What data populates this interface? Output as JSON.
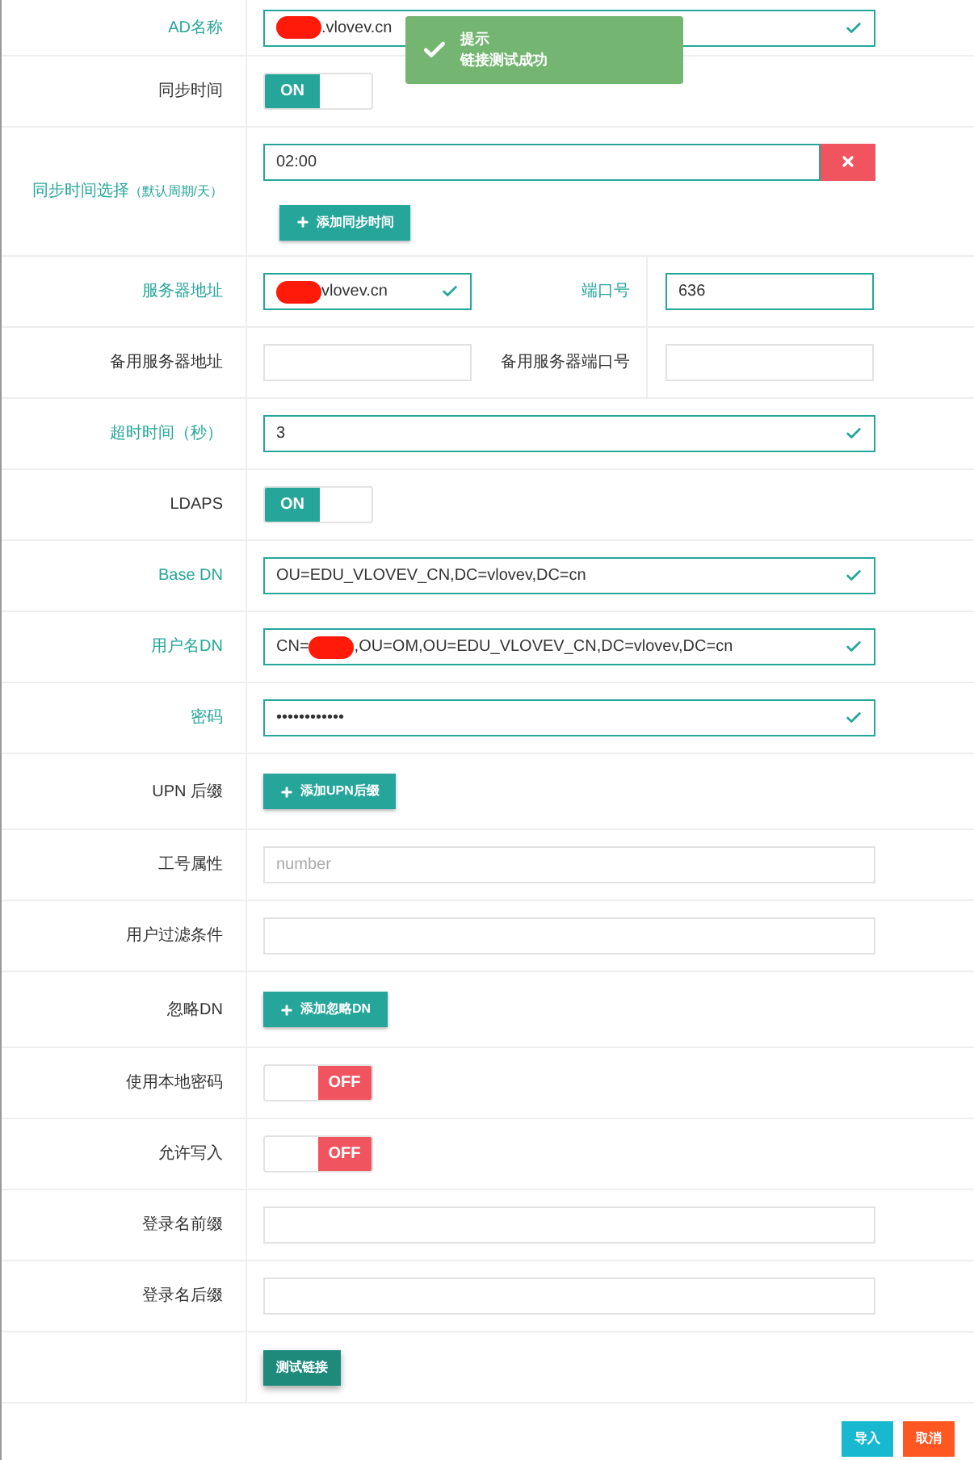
{
  "form_rows": [
    {
      "kind": "input",
      "label": "AD名称",
      "highlighted": true,
      "validated": true,
      "segments": [
        {
          "kind": "redaction"
        },
        {
          "kind": "text",
          "text": ".vlovev.cn"
        }
      ]
    },
    {
      "kind": "switch",
      "label": "同步时间",
      "on": true,
      "switch_text": "ON"
    },
    {
      "kind": "time",
      "label": "同步时间选择",
      "label_note": "（默认周期/天）",
      "highlighted": true,
      "value": "02:00",
      "add_button": "添加同步时间"
    },
    {
      "kind": "dual",
      "fields": [
        {
          "label": "服务器地址",
          "highlighted": true,
          "validated": true,
          "segments": [
            {
              "kind": "redaction"
            },
            {
              "kind": "text",
              "text": "vlovev.cn"
            }
          ]
        },
        {
          "label": "端口号",
          "highlighted": true,
          "validated": false,
          "segments": [
            {
              "kind": "text",
              "text": "636"
            }
          ]
        }
      ]
    },
    {
      "kind": "dual",
      "fields": [
        {
          "label": "备用服务器地址",
          "highlighted": false,
          "validated": false
        },
        {
          "label": "备用服务器端口号",
          "highlighted": false,
          "validated": false
        }
      ]
    },
    {
      "kind": "input",
      "label": "超时时间（秒）",
      "highlighted": true,
      "validated": true,
      "segments": [
        {
          "kind": "text",
          "text": "3"
        }
      ]
    },
    {
      "kind": "switch",
      "label": "LDAPS",
      "on": true,
      "switch_text": "ON"
    },
    {
      "kind": "input",
      "label": "Base DN",
      "highlighted": true,
      "validated": true,
      "segments": [
        {
          "kind": "text",
          "text": "OU=EDU_VLOVEV_CN,DC=vlovev,DC=cn"
        }
      ]
    },
    {
      "kind": "input",
      "label": "用户名DN",
      "highlighted": true,
      "validated": true,
      "segments": [
        {
          "kind": "text",
          "text": "CN="
        },
        {
          "kind": "redaction"
        },
        {
          "kind": "text",
          "text": ",OU=OM,OU=EDU_VLOVEV_CN,DC=vlovev,DC=cn"
        }
      ]
    },
    {
      "kind": "input",
      "label": "密码",
      "highlighted": true,
      "validated": true,
      "segments": [
        {
          "kind": "text",
          "text": "••••••••••••"
        }
      ]
    },
    {
      "kind": "add",
      "label": "UPN 后缀",
      "add_button": "添加UPN后缀"
    },
    {
      "kind": "input",
      "label": "工号属性",
      "highlighted": false,
      "validated": false,
      "placeholder": "number"
    },
    {
      "kind": "input",
      "label": "用户过滤条件",
      "highlighted": false,
      "validated": false
    },
    {
      "kind": "add",
      "label": "忽略DN",
      "add_button": "添加忽略DN"
    },
    {
      "kind": "switch",
      "label": "使用本地密码",
      "on": false,
      "switch_text": "OFF"
    },
    {
      "kind": "switch",
      "label": "允许写入",
      "on": false,
      "switch_text": "OFF"
    },
    {
      "kind": "input",
      "label": "登录名前缀",
      "highlighted": false,
      "validated": false
    },
    {
      "kind": "input",
      "label": "登录名后缀",
      "highlighted": false,
      "validated": false
    },
    {
      "kind": "test",
      "button": "测试链接"
    }
  ],
  "toast": {
    "title": "提示",
    "message": "链接测试成功"
  },
  "footer_buttons": [
    {
      "kind": "primary",
      "label": "导入"
    },
    {
      "kind": "danger",
      "label": "取消"
    }
  ]
}
